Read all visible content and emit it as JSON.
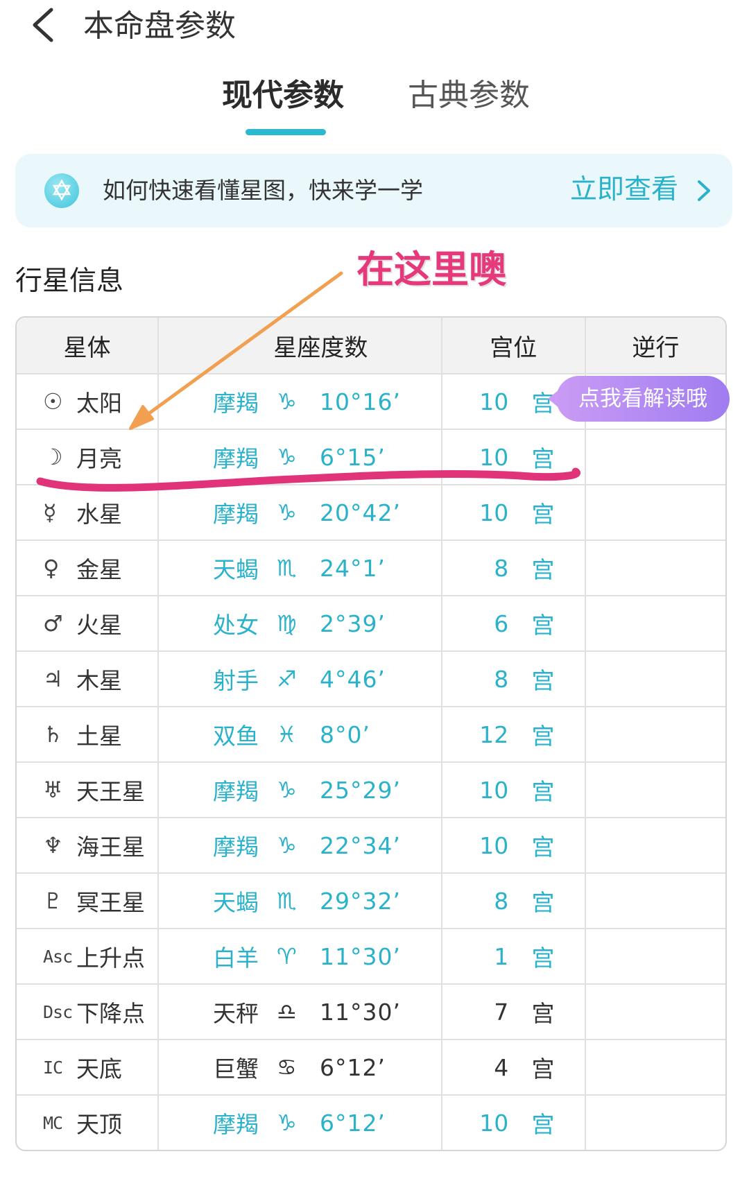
{
  "header": {
    "title": "本命盘参数",
    "back_icon": "chevron-left-icon"
  },
  "tabs": [
    {
      "label": "现代参数",
      "active": true
    },
    {
      "label": "古典参数",
      "active": false
    }
  ],
  "banner": {
    "icon": "star-of-david-icon",
    "text": "如何快速看懂星图，快来学一学",
    "cta": "立即查看",
    "chevron": "chevron-right-icon"
  },
  "annotation": {
    "text": "在这里噢",
    "arrow_color": "#f0a050",
    "underline_color": "#e0337a"
  },
  "section_title": "行星信息",
  "table": {
    "headers": [
      "星体",
      "星座度数",
      "宫位",
      "逆行"
    ],
    "rows": [
      {
        "symbol": "☉",
        "name": "太阳",
        "sign": "摩羯",
        "glyph": "♑",
        "degree": "10°16’",
        "house": "10",
        "house_unit": "宫",
        "retro": "",
        "color": "teal"
      },
      {
        "symbol": "☽",
        "name": "月亮",
        "sign": "摩羯",
        "glyph": "♑",
        "degree": "6°15’",
        "house": "10",
        "house_unit": "宫",
        "retro": "",
        "color": "teal"
      },
      {
        "symbol": "☿",
        "name": "水星",
        "sign": "摩羯",
        "glyph": "♑",
        "degree": "20°42’",
        "house": "10",
        "house_unit": "宫",
        "retro": "",
        "color": "teal"
      },
      {
        "symbol": "♀",
        "name": "金星",
        "sign": "天蝎",
        "glyph": "♏",
        "degree": "24°1’",
        "house": "8",
        "house_unit": "宫",
        "retro": "",
        "color": "teal"
      },
      {
        "symbol": "♂",
        "name": "火星",
        "sign": "处女",
        "glyph": "♍",
        "degree": "2°39’",
        "house": "6",
        "house_unit": "宫",
        "retro": "",
        "color": "teal"
      },
      {
        "symbol": "♃",
        "name": "木星",
        "sign": "射手",
        "glyph": "♐",
        "degree": "4°46’",
        "house": "8",
        "house_unit": "宫",
        "retro": "",
        "color": "teal"
      },
      {
        "symbol": "♄",
        "name": "土星",
        "sign": "双鱼",
        "glyph": "♓",
        "degree": "8°0’",
        "house": "12",
        "house_unit": "宫",
        "retro": "",
        "color": "teal"
      },
      {
        "symbol": "♅",
        "name": "天王星",
        "sign": "摩羯",
        "glyph": "♑",
        "degree": "25°29’",
        "house": "10",
        "house_unit": "宫",
        "retro": "",
        "color": "teal"
      },
      {
        "symbol": "♆",
        "name": "海王星",
        "sign": "摩羯",
        "glyph": "♑",
        "degree": "22°34’",
        "house": "10",
        "house_unit": "宫",
        "retro": "",
        "color": "teal"
      },
      {
        "symbol": "♇",
        "name": "冥王星",
        "sign": "天蝎",
        "glyph": "♏",
        "degree": "29°32’",
        "house": "8",
        "house_unit": "宫",
        "retro": "",
        "color": "teal"
      },
      {
        "symbol": "Asc",
        "name": "上升点",
        "sign": "白羊",
        "glyph": "♈",
        "degree": "11°30’",
        "house": "1",
        "house_unit": "宫",
        "retro": "",
        "color": "teal"
      },
      {
        "symbol": "Dsc",
        "name": "下降点",
        "sign": "天秤",
        "glyph": "♎",
        "degree": "11°30’",
        "house": "7",
        "house_unit": "宫",
        "retro": "",
        "color": "dark"
      },
      {
        "symbol": "IC",
        "name": "天底",
        "sign": "巨蟹",
        "glyph": "♋",
        "degree": "6°12’",
        "house": "4",
        "house_unit": "宫",
        "retro": "",
        "color": "dark"
      },
      {
        "symbol": "MC",
        "name": "天顶",
        "sign": "摩羯",
        "glyph": "♑",
        "degree": "6°12’",
        "house": "10",
        "house_unit": "宫",
        "retro": "",
        "color": "teal"
      }
    ]
  },
  "tooltip": {
    "text": "点我看解读哦"
  },
  "colors": {
    "accent": "#2bb2cb",
    "tab_underline": "#2bb9cf",
    "banner_bg": "#eaf8fb",
    "tooltip": "#b08cf2"
  }
}
